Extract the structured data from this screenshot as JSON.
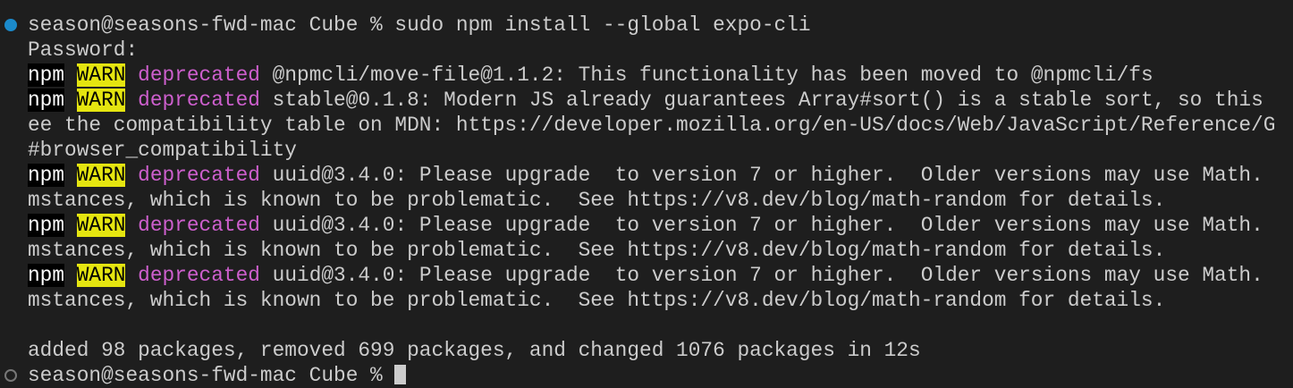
{
  "terminal": {
    "colors": {
      "background": "#1e1e1e",
      "text": "#cccccc",
      "deprecated": "#cd5fcd",
      "warn_bg": "#e5e510",
      "npm_bg": "#000000",
      "prompt_dot": "#1b8acb"
    },
    "lines": [
      {
        "marker": "active",
        "segments": [
          {
            "t": "plain",
            "text": "season@seasons-fwd-mac Cube % sudo npm install --global expo-cli"
          }
        ]
      },
      {
        "segments": [
          {
            "t": "plain",
            "text": "Password:"
          }
        ]
      },
      {
        "segments": [
          {
            "t": "npm",
            "text": "npm"
          },
          {
            "t": "plain",
            "text": " "
          },
          {
            "t": "warn",
            "text": "WARN"
          },
          {
            "t": "plain",
            "text": " "
          },
          {
            "t": "dep",
            "text": "deprecated"
          },
          {
            "t": "plain",
            "text": " @npmcli/move-file@1.1.2: This functionality has been moved to @npmcli/fs"
          }
        ]
      },
      {
        "segments": [
          {
            "t": "npm",
            "text": "npm"
          },
          {
            "t": "plain",
            "text": " "
          },
          {
            "t": "warn",
            "text": "WARN"
          },
          {
            "t": "plain",
            "text": " "
          },
          {
            "t": "dep",
            "text": "deprecated"
          },
          {
            "t": "plain",
            "text": " stable@0.1.8: Modern JS already guarantees Array#sort() is a stable sort, so this"
          }
        ]
      },
      {
        "segments": [
          {
            "t": "plain",
            "text": "ee the compatibility table on MDN: https://developer.mozilla.org/en-US/docs/Web/JavaScript/Reference/G"
          }
        ]
      },
      {
        "segments": [
          {
            "t": "plain",
            "text": "#browser_compatibility"
          }
        ]
      },
      {
        "segments": [
          {
            "t": "npm",
            "text": "npm"
          },
          {
            "t": "plain",
            "text": " "
          },
          {
            "t": "warn",
            "text": "WARN"
          },
          {
            "t": "plain",
            "text": " "
          },
          {
            "t": "dep",
            "text": "deprecated"
          },
          {
            "t": "plain",
            "text": " uuid@3.4.0: Please upgrade  to version 7 or higher.  Older versions may use Math."
          }
        ]
      },
      {
        "segments": [
          {
            "t": "plain",
            "text": "mstances, which is known to be problematic.  See https://v8.dev/blog/math-random for details."
          }
        ]
      },
      {
        "segments": [
          {
            "t": "npm",
            "text": "npm"
          },
          {
            "t": "plain",
            "text": " "
          },
          {
            "t": "warn",
            "text": "WARN"
          },
          {
            "t": "plain",
            "text": " "
          },
          {
            "t": "dep",
            "text": "deprecated"
          },
          {
            "t": "plain",
            "text": " uuid@3.4.0: Please upgrade  to version 7 or higher.  Older versions may use Math."
          }
        ]
      },
      {
        "segments": [
          {
            "t": "plain",
            "text": "mstances, which is known to be problematic.  See https://v8.dev/blog/math-random for details."
          }
        ]
      },
      {
        "segments": [
          {
            "t": "npm",
            "text": "npm"
          },
          {
            "t": "plain",
            "text": " "
          },
          {
            "t": "warn",
            "text": "WARN"
          },
          {
            "t": "plain",
            "text": " "
          },
          {
            "t": "dep",
            "text": "deprecated"
          },
          {
            "t": "plain",
            "text": " uuid@3.4.0: Please upgrade  to version 7 or higher.  Older versions may use Math."
          }
        ]
      },
      {
        "segments": [
          {
            "t": "plain",
            "text": "mstances, which is known to be problematic.  See https://v8.dev/blog/math-random for details."
          }
        ]
      },
      {
        "segments": [
          {
            "t": "plain",
            "text": ""
          }
        ]
      },
      {
        "segments": [
          {
            "t": "plain",
            "text": "added 98 packages, removed 699 packages, and changed 1076 packages in 12s"
          }
        ]
      },
      {
        "marker": "idle",
        "cursor": true,
        "segments": [
          {
            "t": "plain",
            "text": "season@seasons-fwd-mac Cube % "
          }
        ]
      }
    ]
  }
}
